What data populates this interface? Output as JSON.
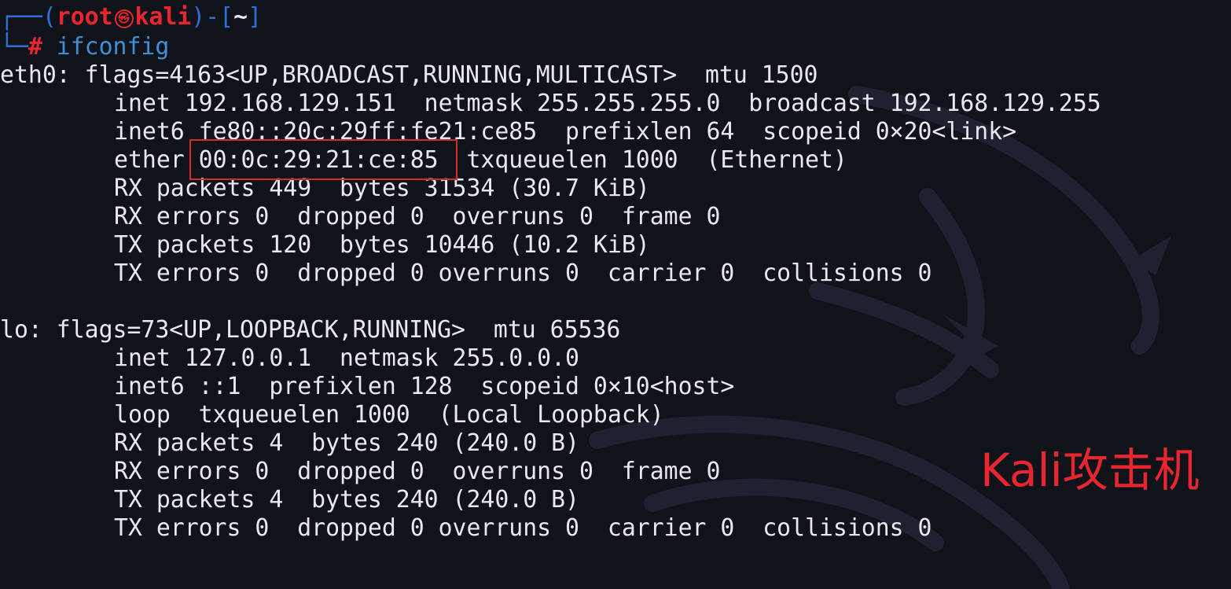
{
  "prompt": {
    "corner_top": "┌──(",
    "user": "root",
    "separator_icon": "㉿",
    "host": "kali",
    "close_bracket": ")-[",
    "cwd": "~",
    "end_bracket": "]",
    "corner_bottom": "└─",
    "hash": "#",
    "command": "ifconfig"
  },
  "output": {
    "eth0": {
      "header": "eth0: flags=4163<UP,BROADCAST,RUNNING,MULTICAST>  mtu 1500",
      "inet": "inet 192.168.129.151  netmask 255.255.255.0  broadcast 192.168.129.255",
      "inet6": "inet6 fe80::20c:29ff:fe21:ce85  prefixlen 64  scopeid 0×20<link>",
      "ether": "ether 00:0c:29:21:ce:85  txqueuelen 1000  (Ethernet)",
      "rx_packets": "RX packets 449  bytes 31534 (30.7 KiB)",
      "rx_errors": "RX errors 0  dropped 0  overruns 0  frame 0",
      "tx_packets": "TX packets 120  bytes 10446 (10.2 KiB)",
      "tx_errors": "TX errors 0  dropped 0 overruns 0  carrier 0  collisions 0"
    },
    "lo": {
      "header": "lo: flags=73<UP,LOOPBACK,RUNNING>  mtu 65536",
      "inet": "inet 127.0.0.1  netmask 255.0.0.0",
      "inet6": "inet6 ::1  prefixlen 128  scopeid 0×10<host>",
      "loop": "loop  txqueuelen 1000  (Local Loopback)",
      "rx_packets": "RX packets 4  bytes 240 (240.0 B)",
      "rx_errors": "RX errors 0  dropped 0  overruns 0  frame 0",
      "tx_packets": "TX packets 4  bytes 240 (240.0 B)",
      "tx_errors": "TX errors 0  dropped 0 overruns 0  carrier 0  collisions 0"
    }
  },
  "annotation": {
    "label": "Kali攻击机"
  },
  "colors": {
    "background": "#11131b",
    "text": "#e8e8ee",
    "prompt_red": "#e8262f",
    "prompt_blue": "#2f6fd6",
    "command_blue": "#3e8fd8",
    "annotation_red": "#e8262f"
  },
  "icons": {
    "separator": "kali-skull-icon",
    "watermark": "kali-dragon-watermark-icon"
  }
}
